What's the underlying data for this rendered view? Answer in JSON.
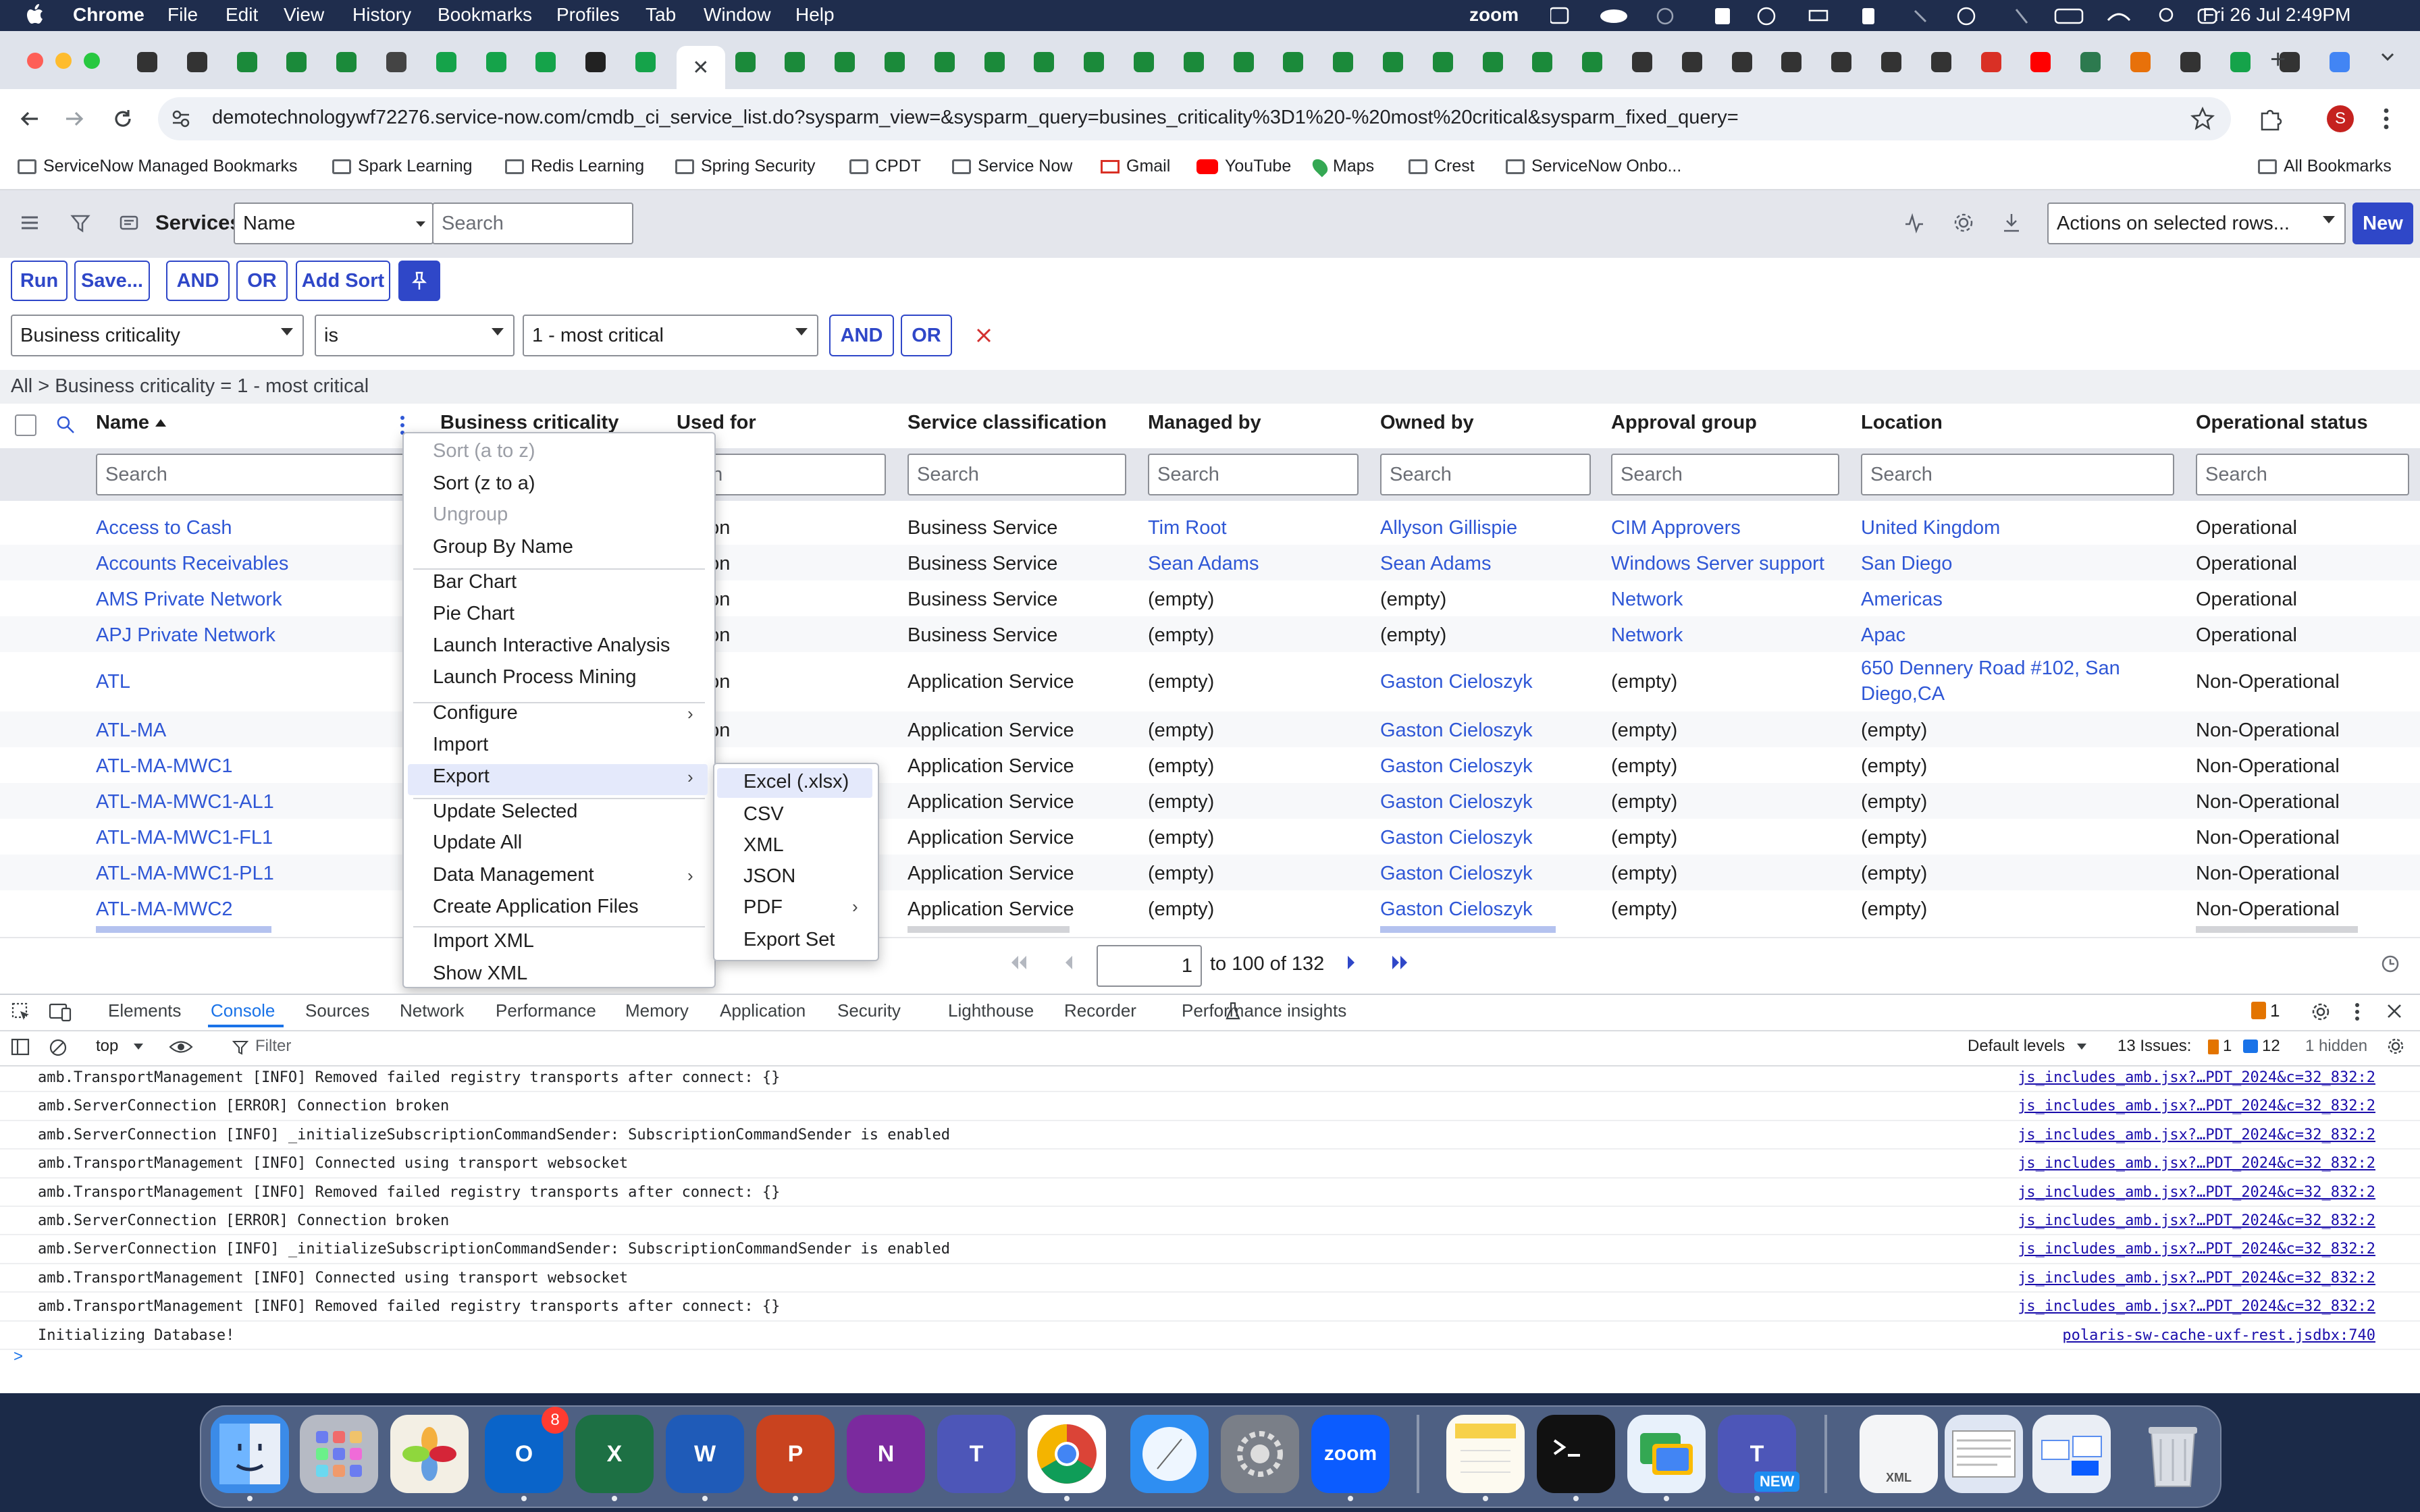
{
  "menubar": {
    "app": "Chrome",
    "items": [
      "File",
      "Edit",
      "View",
      "History",
      "Bookmarks",
      "Profiles",
      "Tab",
      "Window",
      "Help"
    ],
    "zoom_label": "zoom",
    "datetime": "Fri 26 Jul  2:49PM"
  },
  "browser": {
    "url": "demotechnologywf72276.service-now.com/cmdb_ci_service_list.do?sysparm_view=&sysparm_query=busines_criticality%3D1%20-%20most%20critical&sysparm_fixed_query=",
    "bookmarks": [
      "ServiceNow Managed Bookmarks",
      "Spark Learning",
      "Redis Learning",
      "Spring Security",
      "CPDT",
      "Service Now",
      "Gmail",
      "YouTube",
      "Maps",
      "Crest",
      "ServiceNow Onbo..."
    ],
    "all_bookmarks": "All Bookmarks",
    "avatar_letter": "S"
  },
  "list": {
    "title": "Services",
    "search_field": "Name",
    "search_placeholder": "Search",
    "actions_label": "Actions on selected rows...",
    "new_label": "New",
    "buttons": {
      "run": "Run",
      "save": "Save...",
      "and": "AND",
      "or": "OR",
      "add_sort": "Add Sort"
    },
    "condition": {
      "field": "Business criticality",
      "operator": "is",
      "value": "1 - most critical",
      "and": "AND",
      "or": "OR"
    },
    "breadcrumb": "All > Business criticality = 1 - most critical",
    "columns": [
      "Name",
      "Business criticality",
      "Used for",
      "Service classification",
      "Managed by",
      "Owned by",
      "Approval group",
      "Location",
      "Operational status"
    ],
    "search_cell": "Search",
    "search_cell_partial": "rch",
    "rows": [
      {
        "name": "Access to Cash",
        "used": "uction",
        "cls": "Business Service",
        "managed": "Tim Root",
        "owned": "Allyson Gillispie",
        "group": "CIM Approvers",
        "loc": "United Kingdom",
        "status": "Operational"
      },
      {
        "name": "Accounts Receivables",
        "used": "uction",
        "cls": "Business Service",
        "managed": "Sean Adams",
        "owned": "Sean Adams",
        "group": "Windows Server support",
        "loc": "San Diego",
        "status": "Operational"
      },
      {
        "name": "AMS Private Network",
        "used": "uction",
        "cls": "Business Service",
        "managed": "(empty)",
        "owned": "(empty)",
        "group": "Network",
        "loc": "Americas",
        "status": "Operational"
      },
      {
        "name": "APJ Private Network",
        "used": "uction",
        "cls": "Business Service",
        "managed": "(empty)",
        "owned": "(empty)",
        "group": "Network",
        "loc": "Apac",
        "status": "Operational"
      },
      {
        "name": "ATL",
        "used": "uction",
        "cls": "Application Service",
        "managed": "(empty)",
        "owned": "Gaston Cieloszyk",
        "group": "(empty)",
        "loc": "650 Dennery Road #102, San",
        "loc2": "Diego,CA",
        "status": "Non-Operational"
      },
      {
        "name": "ATL-MA",
        "used": "uction",
        "cls": "Application Service",
        "managed": "(empty)",
        "owned": "Gaston Cieloszyk",
        "group": "(empty)",
        "loc": "(empty)",
        "status": "Non-Operational"
      },
      {
        "name": "ATL-MA-MWC1",
        "used": "",
        "cls": "Application Service",
        "managed": "(empty)",
        "owned": "Gaston Cieloszyk",
        "group": "(empty)",
        "loc": "(empty)",
        "status": "Non-Operational"
      },
      {
        "name": "ATL-MA-MWC1-AL1",
        "used": "",
        "cls": "Application Service",
        "managed": "(empty)",
        "owned": "Gaston Cieloszyk",
        "group": "(empty)",
        "loc": "(empty)",
        "status": "Non-Operational"
      },
      {
        "name": "ATL-MA-MWC1-FL1",
        "used": "",
        "cls": "Application Service",
        "managed": "(empty)",
        "owned": "Gaston Cieloszyk",
        "group": "(empty)",
        "loc": "(empty)",
        "status": "Non-Operational"
      },
      {
        "name": "ATL-MA-MWC1-PL1",
        "used": "",
        "cls": "Application Service",
        "managed": "(empty)",
        "owned": "Gaston Cieloszyk",
        "group": "(empty)",
        "loc": "(empty)",
        "status": "Non-Operational"
      },
      {
        "name": "ATL-MA-MWC2",
        "used": "",
        "cls": "Application Service",
        "managed": "(empty)",
        "owned": "Gaston Cieloszyk",
        "group": "(empty)",
        "loc": "(empty)",
        "status": "Non-Operational"
      }
    ],
    "pagination": {
      "page": "1",
      "range": "to 100 of 132"
    }
  },
  "context_menu": {
    "items": [
      {
        "label": "Sort (a to z)",
        "disabled": true
      },
      {
        "label": "Sort (z to a)"
      },
      {
        "label": "Ungroup",
        "disabled": true
      },
      {
        "label": "Group By Name"
      },
      {
        "label": "Bar Chart"
      },
      {
        "label": "Pie Chart"
      },
      {
        "label": "Launch Interactive Analysis"
      },
      {
        "label": "Launch Process Mining"
      },
      {
        "label": "Configure",
        "submenu": true
      },
      {
        "label": "Import"
      },
      {
        "label": "Export",
        "submenu": true
      },
      {
        "label": "Update Selected"
      },
      {
        "label": "Update All"
      },
      {
        "label": "Data Management",
        "submenu": true
      },
      {
        "label": "Create Application Files"
      },
      {
        "label": "Import XML"
      },
      {
        "label": "Show XML"
      }
    ],
    "export_submenu": [
      "Excel (.xlsx)",
      "CSV",
      "XML",
      "JSON",
      "PDF",
      "Export Set"
    ]
  },
  "devtools": {
    "tabs": [
      "Elements",
      "Console",
      "Sources",
      "Network",
      "Performance",
      "Memory",
      "Application",
      "Security",
      "Lighthouse",
      "Recorder",
      "Performance insights"
    ],
    "active_tab": "Console",
    "warning_count": "1",
    "context": "top",
    "filter_placeholder": "Filter",
    "levels": "Default levels",
    "issues_label": "13 Issues:",
    "issues_warn": "1",
    "issues_info": "12",
    "hidden": "1 hidden",
    "lines": [
      {
        "text": "amb.TransportManagement [INFO] Removed failed registry transports after connect: {}",
        "src": "js_includes_amb.jsx?…PDT_2024&c=32_832:2"
      },
      {
        "text": "amb.ServerConnection [ERROR] Connection broken",
        "src": "js_includes_amb.jsx?…PDT_2024&c=32_832:2"
      },
      {
        "text": "amb.ServerConnection [INFO] _initializeSubscriptionCommandSender: SubscriptionCommandSender is enabled",
        "src": "js_includes_amb.jsx?…PDT_2024&c=32_832:2"
      },
      {
        "text": "amb.TransportManagement [INFO] Connected using transport websocket",
        "src": "js_includes_amb.jsx?…PDT_2024&c=32_832:2"
      },
      {
        "text": "amb.TransportManagement [INFO] Removed failed registry transports after connect: {}",
        "src": "js_includes_amb.jsx?…PDT_2024&c=32_832:2"
      },
      {
        "text": "amb.ServerConnection [ERROR] Connection broken",
        "src": "js_includes_amb.jsx?…PDT_2024&c=32_832:2"
      },
      {
        "text": "amb.ServerConnection [INFO] _initializeSubscriptionCommandSender: SubscriptionCommandSender is enabled",
        "src": "js_includes_amb.jsx?…PDT_2024&c=32_832:2"
      },
      {
        "text": "amb.TransportManagement [INFO] Connected using transport websocket",
        "src": "js_includes_amb.jsx?…PDT_2024&c=32_832:2"
      },
      {
        "text": "amb.TransportManagement [INFO] Removed failed registry transports after connect: {}",
        "src": "js_includes_amb.jsx?…PDT_2024&c=32_832:2"
      },
      {
        "text": "Initializing Database!",
        "src": "polaris-sw-cache-uxf-rest.jsdbx:740"
      }
    ],
    "prompt": ">"
  },
  "dock": {
    "outlook_badge": "8",
    "zoom_label": "zoom",
    "teams_new": "NEW",
    "xml_label": "XML"
  },
  "colors": {
    "accent": "#2f47c8",
    "link": "#2f57d6",
    "menubar": "#1f2d4d"
  }
}
